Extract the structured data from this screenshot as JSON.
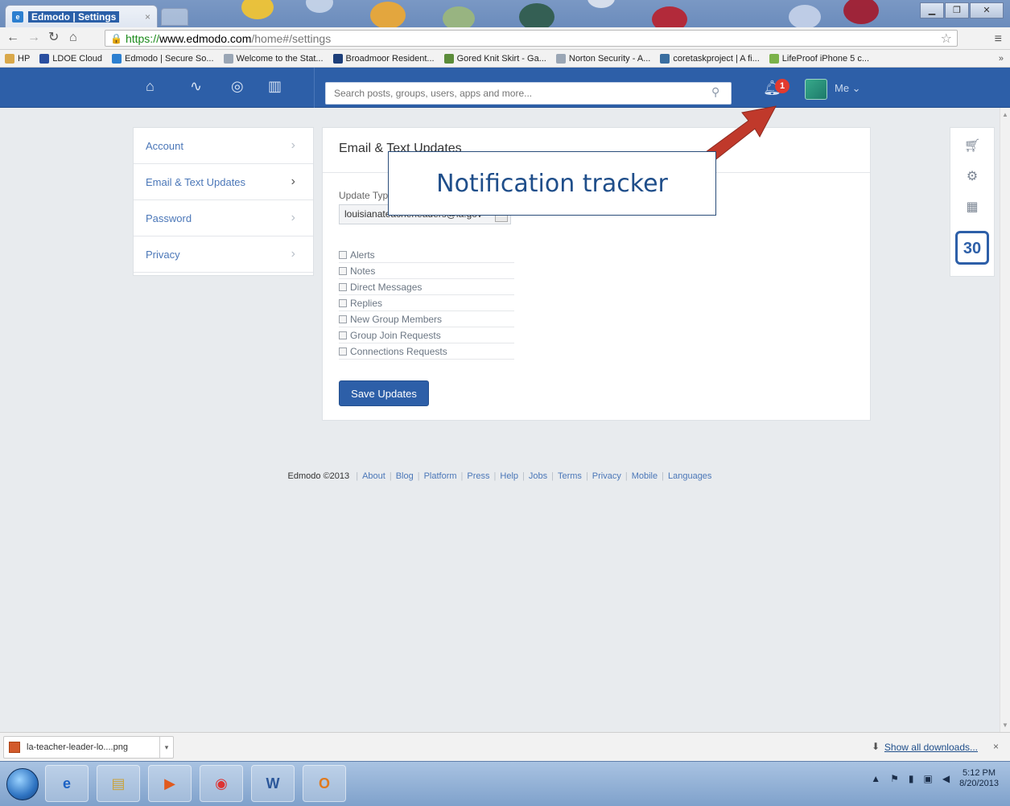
{
  "browser": {
    "tab_title": "Edmodo | Settings",
    "tab_close": "×",
    "url_scheme": "https://",
    "url_host": "www.edmodo.com",
    "url_path": "/home#/settings",
    "bookmarks": [
      {
        "label": "HP",
        "icon": "folder-icon",
        "color": "#d9a84a"
      },
      {
        "label": "LDOE Cloud",
        "icon": "ldoe-icon",
        "color": "#2a4fa0"
      },
      {
        "label": "Edmodo | Secure So...",
        "icon": "edmodo-icon",
        "color": "#2c7fd0"
      },
      {
        "label": "Welcome to the Stat...",
        "icon": "page-icon",
        "color": "#9aa6b5"
      },
      {
        "label": "Broadmoor Resident...",
        "icon": "b-icon",
        "color": "#1d3f7a"
      },
      {
        "label": "Gored Knit Skirt - Ga...",
        "icon": "gh-icon",
        "color": "#5b8c3a"
      },
      {
        "label": "Norton Security - A...",
        "icon": "page-icon",
        "color": "#9aa6b5"
      },
      {
        "label": "coretaskproject | A fi...",
        "icon": "wordpress-icon",
        "color": "#3a6ea0"
      },
      {
        "label": "LifeProof iPhone 5 c...",
        "icon": "lifeproof-icon",
        "color": "#7bb24a"
      }
    ],
    "bookmarks_more": "»"
  },
  "header": {
    "search_placeholder": "Search posts, groups, users, apps and more...",
    "notification_count": "1",
    "me_label": "Me ⌄"
  },
  "settings_menu": {
    "items": [
      {
        "label": "Account",
        "active": false
      },
      {
        "label": "Email & Text Updates",
        "active": true
      },
      {
        "label": "Password",
        "active": false
      },
      {
        "label": "Privacy",
        "active": false
      }
    ]
  },
  "panel": {
    "title": "Email & Text Updates",
    "update_type_label": "Update Type",
    "email_value": "louisianateacherleaders@la.gov",
    "checkboxes": [
      "Alerts",
      "Notes",
      "Direct Messages",
      "Replies",
      "New Group Members",
      "Group Join Requests",
      "Connections Requests"
    ],
    "save_label": "Save Updates"
  },
  "rail": {
    "calendar_day": "30"
  },
  "footer": {
    "copyright": "Edmodo ©2013",
    "links": [
      "About",
      "Blog",
      "Platform",
      "Press",
      "Help",
      "Jobs",
      "Terms",
      "Privacy",
      "Mobile",
      "Languages"
    ]
  },
  "annotation": {
    "label": "Notification tracker",
    "arrow_color": "#c0392b"
  },
  "downloads": {
    "file_name": "la-teacher-leader-lo....png",
    "show_all": "Show all downloads...",
    "close": "×"
  },
  "taskbar": {
    "time": "5:12 PM",
    "date": "8/20/2013"
  },
  "colors": {
    "edmodo_blue": "#2d5fa8",
    "link_blue": "#4b77b8",
    "badge_red": "#e23a2e"
  }
}
